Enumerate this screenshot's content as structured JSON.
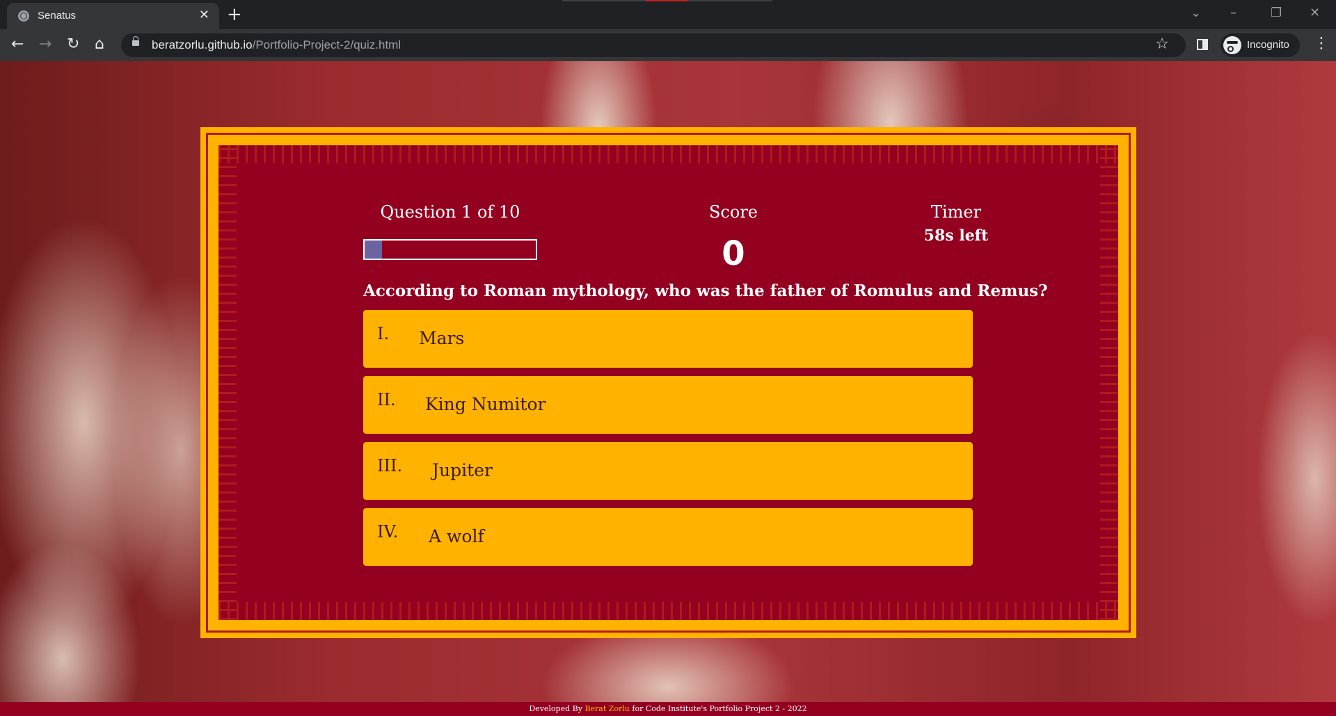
{
  "browser": {
    "tab_title": "Senatus",
    "tab_close": "✕",
    "new_tab": "+",
    "url_host": "beratzorlu.github.io",
    "url_path": "/Portfolio-Project-2/quiz.html",
    "profile_label": "Incognito",
    "window_controls": {
      "tab_search": "⌄",
      "minimize": "–",
      "restore": "❐",
      "close": "✕"
    },
    "nav": {
      "back": "←",
      "forward": "→",
      "reload": "↻",
      "home": "⌂"
    },
    "star": "☆",
    "menu": "⋮"
  },
  "quiz": {
    "question_counter": "Question 1 of 10",
    "progress": 0.1,
    "score_label": "Score",
    "score_value": "0",
    "timer_label": "Timer",
    "timer_value": "58s left",
    "question": "According to Roman mythology, who was the father of Romulus and Remus?",
    "answers": [
      {
        "number": "I.",
        "text": "Mars"
      },
      {
        "number": "II.",
        "text": "King Numitor"
      },
      {
        "number": "III.",
        "text": "Jupiter"
      },
      {
        "number": "IV.",
        "text": "A wolf"
      }
    ]
  },
  "footer": {
    "prefix": "Developed By ",
    "author": "Berat Zorlu",
    "suffix": " for Code Institute's Portfolio Project 2 - 2022"
  },
  "colors": {
    "frame_gold": "#ffb300",
    "panel_red": "#930020",
    "progress_fill": "#6a64a0"
  }
}
